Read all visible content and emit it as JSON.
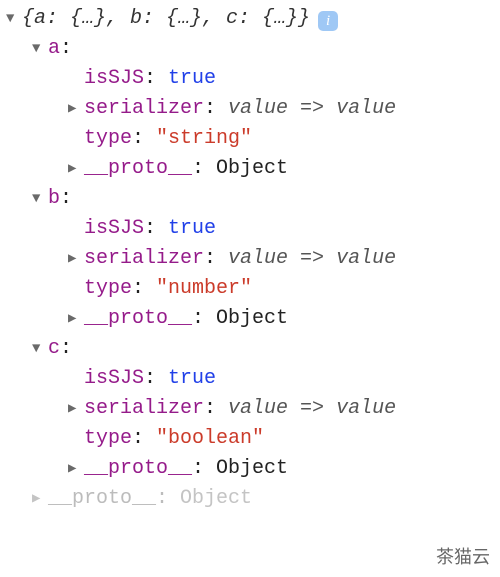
{
  "glyphs": {
    "down": "▼",
    "right": "▶",
    "info": "i"
  },
  "summary": "{a: {…}, b: {…}, c: {…}}",
  "entries": [
    {
      "key": "a",
      "props": [
        {
          "key": "isSJS",
          "kind": "bool",
          "value": "true"
        },
        {
          "key": "serializer",
          "kind": "fn",
          "value": "value => value",
          "expandable": true
        },
        {
          "key": "type",
          "kind": "string",
          "value": "\"string\""
        },
        {
          "key": "__proto__",
          "kind": "proto",
          "value": "Object",
          "expandable": true
        }
      ]
    },
    {
      "key": "b",
      "props": [
        {
          "key": "isSJS",
          "kind": "bool",
          "value": "true"
        },
        {
          "key": "serializer",
          "kind": "fn",
          "value": "value => value",
          "expandable": true
        },
        {
          "key": "type",
          "kind": "string",
          "value": "\"number\""
        },
        {
          "key": "__proto__",
          "kind": "proto",
          "value": "Object",
          "expandable": true
        }
      ]
    },
    {
      "key": "c",
      "props": [
        {
          "key": "isSJS",
          "kind": "bool",
          "value": "true"
        },
        {
          "key": "serializer",
          "kind": "fn",
          "value": "value => value",
          "expandable": true
        },
        {
          "key": "type",
          "kind": "string",
          "value": "\"boolean\""
        },
        {
          "key": "__proto__",
          "kind": "proto",
          "value": "Object",
          "expandable": true
        }
      ]
    }
  ],
  "outer_proto": {
    "key": "__proto__",
    "value": "Object"
  },
  "watermark": "茶猫云"
}
